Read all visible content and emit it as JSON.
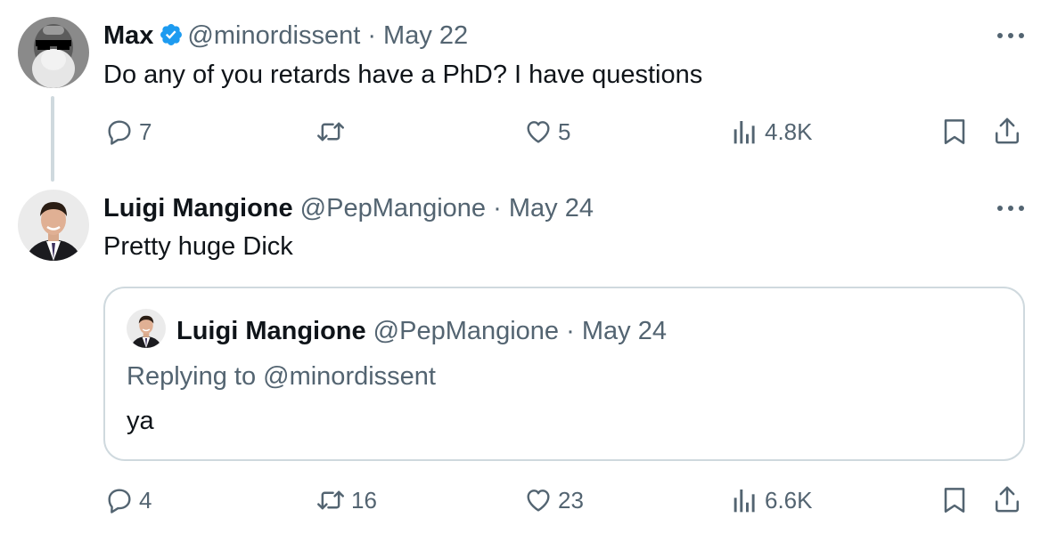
{
  "tweet1": {
    "name": "Max",
    "handle": "@minordissent",
    "sep": " · ",
    "date": "May 22",
    "text": "Do any of you retards have a PhD? I have questions",
    "actions": {
      "reply": "7",
      "retweet": "",
      "like": "5",
      "views": "4.8K"
    }
  },
  "tweet2": {
    "name": "Luigi Mangione",
    "handle": "@PepMangione",
    "sep": " · ",
    "date": "May 24",
    "text": "Pretty huge Dick",
    "quote": {
      "name": "Luigi Mangione",
      "handle": "@PepMangione",
      "sep": " · ",
      "date": "May 24",
      "replying": "Replying to @minordissent",
      "text": "ya"
    },
    "actions": {
      "reply": "4",
      "retweet": "16",
      "like": "23",
      "views": "6.6K"
    }
  },
  "colors": {
    "text": "#0f1419",
    "muted": "#536471",
    "verified": "#1d9bf0",
    "border": "#cfd9de"
  }
}
